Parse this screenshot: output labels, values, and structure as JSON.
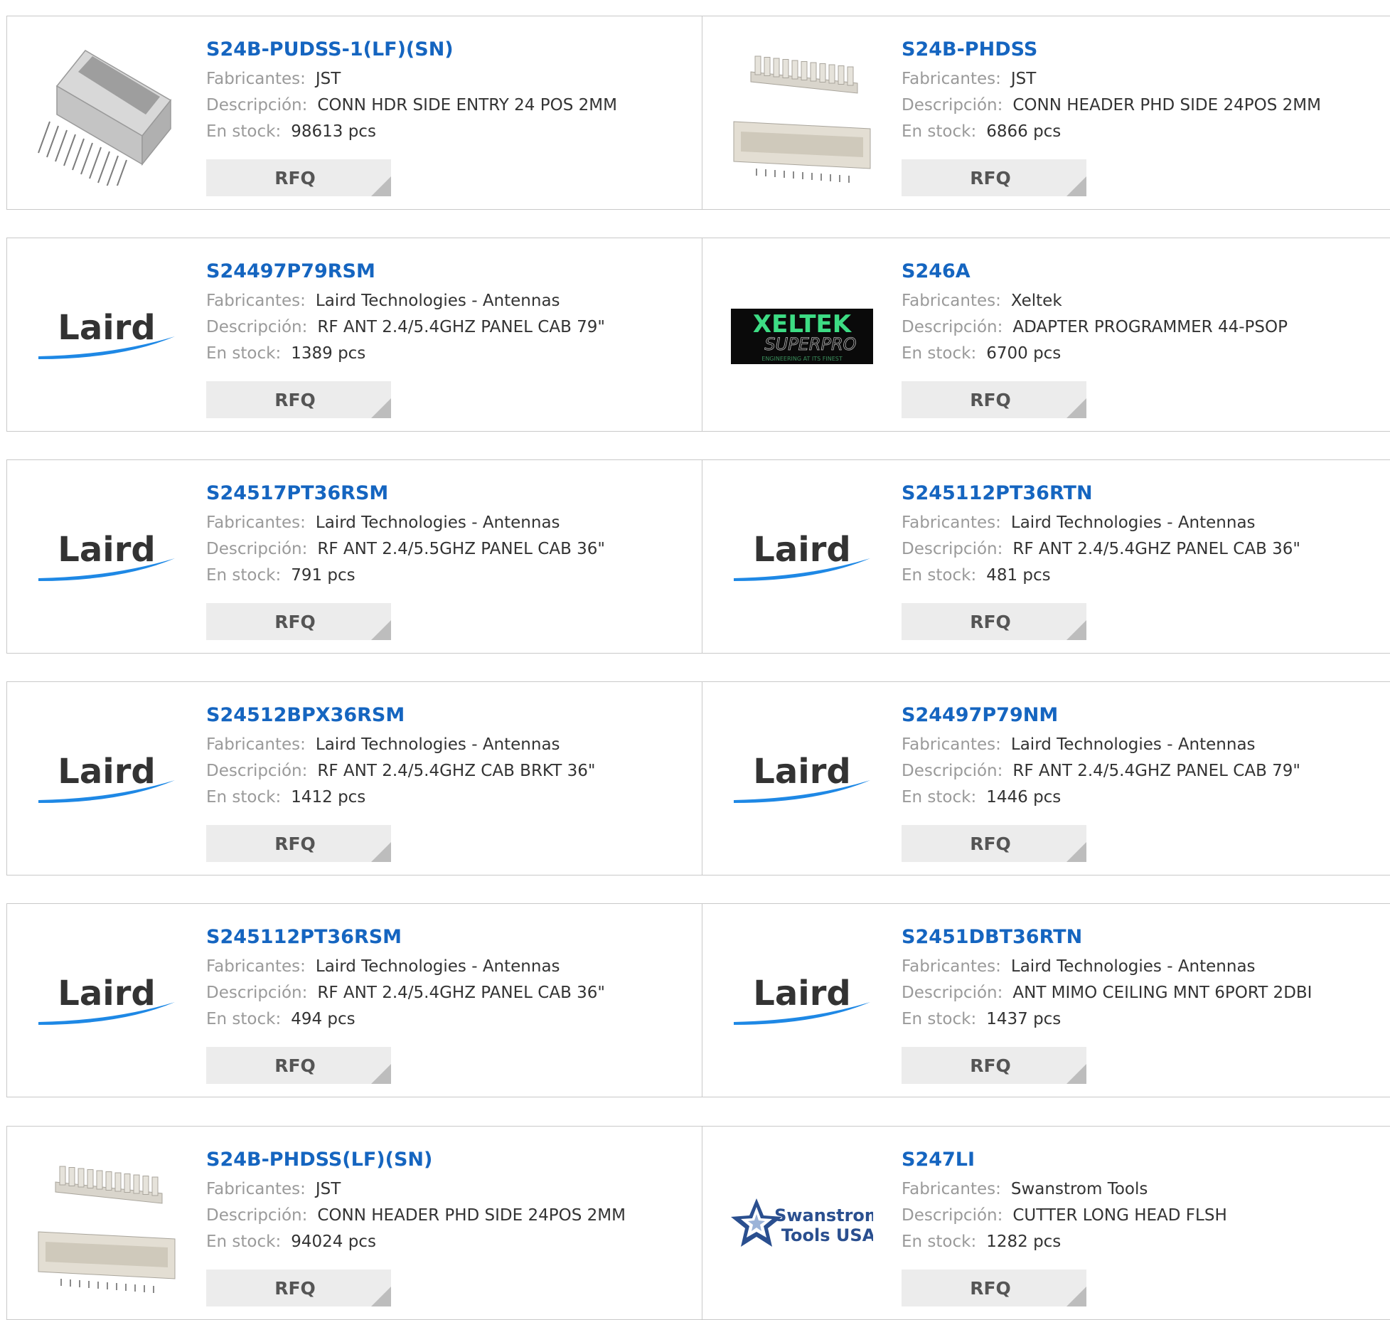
{
  "labels": {
    "manufacturer": "Fabricantes:",
    "description": "Descripción:",
    "stock": "En stock:",
    "rfq": "RFQ"
  },
  "brand_logos": {
    "laird": "Laird",
    "xeltek_top": "XELTEK",
    "xeltek_mid": "SUPERPRO",
    "xeltek_tag": "ENGINEERING AT ITS FINEST",
    "swanstrom_1": "Swanstrom",
    "swanstrom_2": "Tools USA"
  },
  "colors": {
    "link": "#1565c0",
    "label": "#9a9a9a",
    "value": "#333333",
    "rfq_bg": "#ececec",
    "border": "#c9c9c9",
    "laird_text": "#333333",
    "laird_swoosh": "#1e88e5",
    "xeltek_green": "#3ddc84",
    "swanstrom_blue": "#2a4f8f"
  },
  "products": [
    {
      "part": "S24B-PUDSS-1(LF)(SN)",
      "manufacturer": "JST",
      "description": "CONN HDR SIDE ENTRY 24 POS 2MM",
      "stock": "98613 pcs",
      "image": "connector-header-icon"
    },
    {
      "part": "S24B-PHDSS",
      "manufacturer": "JST",
      "description": "CONN HEADER PHD SIDE 24POS 2MM",
      "stock": "6866 pcs",
      "image": "connector-pair-icon"
    },
    {
      "part": "S24497P79RSM",
      "manufacturer": "Laird Technologies - Antennas",
      "description": "RF ANT 2.4/5.4GHZ PANEL CAB 79\"",
      "stock": "1389 pcs",
      "image": "laird-logo"
    },
    {
      "part": "S246A",
      "manufacturer": "Xeltek",
      "description": "ADAPTER PROGRAMMER 44-PSOP",
      "stock": "6700 pcs",
      "image": "xeltek-logo"
    },
    {
      "part": "S24517PT36RSM",
      "manufacturer": "Laird Technologies - Antennas",
      "description": "RF ANT 2.4/5.5GHZ PANEL CAB 36\"",
      "stock": "791 pcs",
      "image": "laird-logo"
    },
    {
      "part": "S245112PT36RTN",
      "manufacturer": "Laird Technologies - Antennas",
      "description": "RF ANT 2.4/5.4GHZ PANEL CAB 36\"",
      "stock": "481 pcs",
      "image": "laird-logo"
    },
    {
      "part": "S24512BPX36RSM",
      "manufacturer": "Laird Technologies - Antennas",
      "description": "RF ANT 2.4/5.4GHZ CAB BRKT 36\"",
      "stock": "1412 pcs",
      "image": "laird-logo"
    },
    {
      "part": "S24497P79NM",
      "manufacturer": "Laird Technologies - Antennas",
      "description": "RF ANT 2.4/5.4GHZ PANEL CAB 79\"",
      "stock": "1446 pcs",
      "image": "laird-logo"
    },
    {
      "part": "S245112PT36RSM",
      "manufacturer": "Laird Technologies - Antennas",
      "description": "RF ANT 2.4/5.4GHZ PANEL CAB 36\"",
      "stock": "494 pcs",
      "image": "laird-logo"
    },
    {
      "part": "S2451DBT36RTN",
      "manufacturer": "Laird Technologies - Antennas",
      "description": "ANT MIMO CEILING MNT 6PORT 2DBI",
      "stock": "1437 pcs",
      "image": "laird-logo"
    },
    {
      "part": "S24B-PHDSS(LF)(SN)",
      "manufacturer": "JST",
      "description": "CONN HEADER PHD SIDE 24POS 2MM",
      "stock": "94024 pcs",
      "image": "connector-pair-icon"
    },
    {
      "part": "S247LI",
      "manufacturer": "Swanstrom Tools",
      "description": "CUTTER LONG HEAD FLSH",
      "stock": "1282 pcs",
      "image": "swanstrom-logo"
    }
  ]
}
